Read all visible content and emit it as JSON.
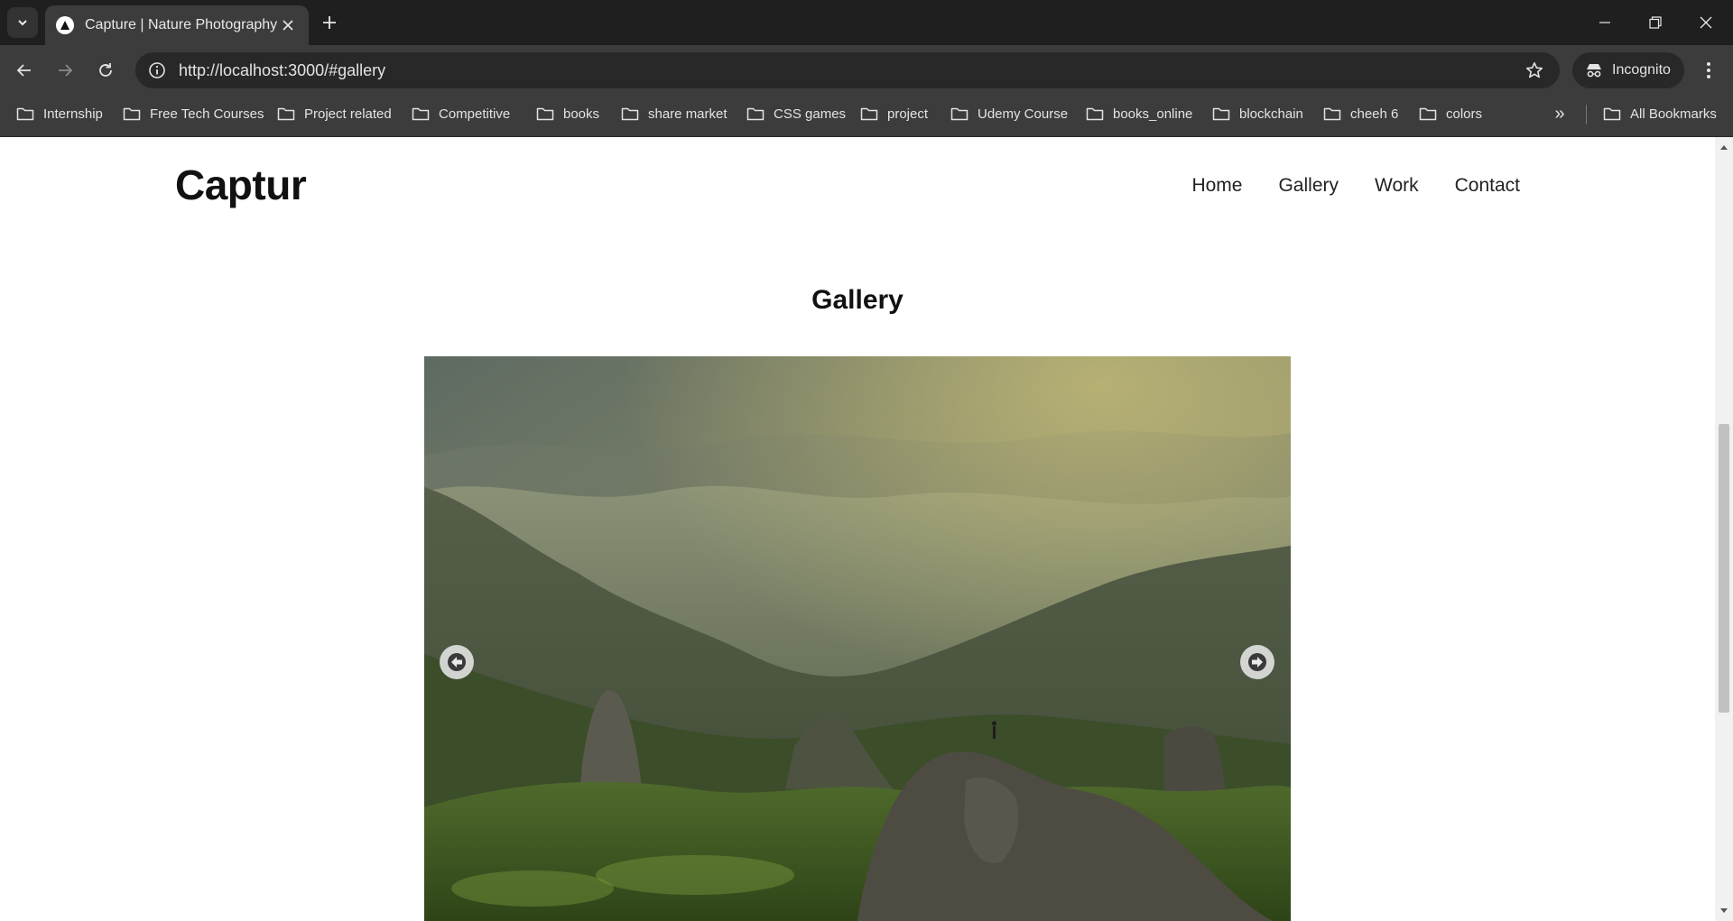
{
  "browser": {
    "tab_title": "Capture | Nature Photography",
    "url": "http://localhost:3000/#gallery",
    "incognito_label": "Incognito",
    "bookmarks": [
      "Internship",
      "Free Tech Courses",
      "Project related",
      "Competitive",
      "books",
      "share market",
      "CSS games",
      "project",
      "Udemy Course",
      "books_online",
      "blockchain",
      "cheeh 6",
      "colors"
    ],
    "more_bookmarks": "»",
    "all_bookmarks": "All Bookmarks"
  },
  "site": {
    "logo": "Captur",
    "nav": [
      "Home",
      "Gallery",
      "Work",
      "Contact"
    ],
    "section_title": "Gallery"
  },
  "colors": {
    "chrome_dark": "#1f1f1f",
    "chrome_toolbar": "#3c3c3c",
    "page_bg": "#ffffff"
  }
}
